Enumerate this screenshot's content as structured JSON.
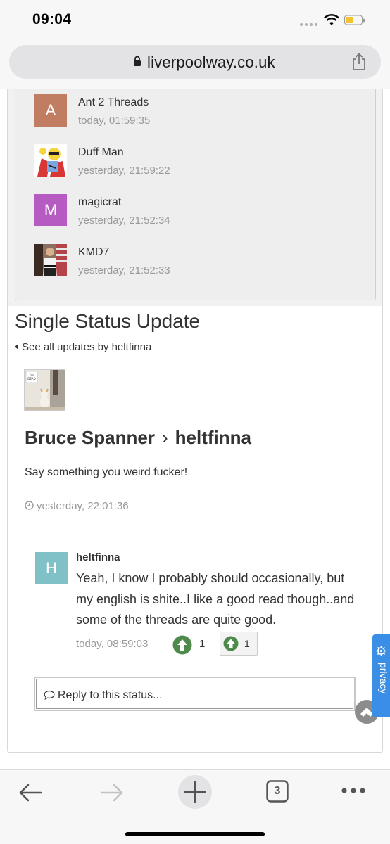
{
  "status_bar": {
    "time": "09:04"
  },
  "browser": {
    "url": "liverpoolway.co.uk",
    "tab_count": "3"
  },
  "visitors": [
    {
      "name": "Ant 2 Threads",
      "time": "today, 01:59:35",
      "initial": "A",
      "color": "#c17d62"
    },
    {
      "name": "Duff Man",
      "time": "yesterday, 21:59:22",
      "initial": "",
      "color": "#ffffff"
    },
    {
      "name": "magicrat",
      "time": "yesterday, 21:52:34",
      "initial": "M",
      "color": "#b65bc1"
    },
    {
      "name": "KMD7",
      "time": "yesterday, 21:52:33",
      "initial": "",
      "color": "#6b5446"
    }
  ],
  "section": {
    "title": "Single Status Update",
    "see_all": "See all updates by heltfinna"
  },
  "status": {
    "author": "Bruce Spanner",
    "target": "heltfinna",
    "text": "Say something you weird fucker!",
    "time": "yesterday, 22:01:36"
  },
  "comment": {
    "initial": "H",
    "author": "heltfinna",
    "text": "Yeah, I know I probably should occasionally, but my english is shite..I like a good read though..and some of the threads are quite good.",
    "time": "today, 08:59:03",
    "reputation": "1",
    "reputation_box": "1"
  },
  "reply": {
    "label": "Reply to this status..."
  },
  "privacy": {
    "label": "privacy"
  },
  "colors": {
    "rep_green": "#4d8a4c",
    "privacy_blue": "#3a8ee6",
    "comment_avatar": "#7fc1c6"
  }
}
